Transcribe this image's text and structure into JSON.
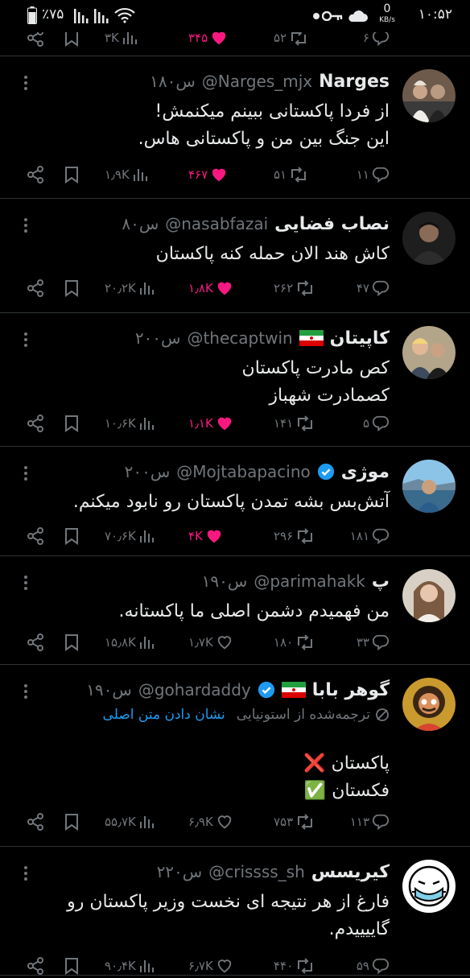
{
  "status_bar": {
    "time": "۱۰:۵۲",
    "net_speed_value": "0",
    "net_speed_unit": "KB/s",
    "battery": "٪۷۵",
    "icons": [
      "dot-icon",
      "key-icon",
      "cloud-icon",
      "wifi-icon",
      "signal-icon",
      "battery-icon"
    ]
  },
  "colors": {
    "background": "#000000",
    "text": "#e7e9ea",
    "muted": "#71767b",
    "like": "#f91880",
    "link": "#1d9bf0",
    "verified": "#1d9bf0"
  },
  "top_actions": {
    "replies": "۶",
    "retweets": "۵۲",
    "likes": "۳۴۵",
    "views": "۳K"
  },
  "tweets": [
    {
      "name": "Narges",
      "handle": "@Narges_mjx",
      "time": "۱۸۰س",
      "lines": [
        "از فردا پاکستانی ببینم میکنمش!",
        "این جنگ بین من و پاکستانی هاس."
      ],
      "replies": "۱۱",
      "retweets": "۵۱",
      "likes": "۴۶۷",
      "views": "۱٫۹K",
      "liked": true
    },
    {
      "name": "نصاب فضایی",
      "handle": "@nasabfazai",
      "time": "۸۰س",
      "lines": [
        "کاش هند الان حمله کنه پاکستان"
      ],
      "replies": "۴۷",
      "retweets": "۲۶۲",
      "likes": "۱٫۸K",
      "views": "۲۰٫۲K",
      "liked": true
    },
    {
      "name": "کاپیتان",
      "handle": "@thecaptwin",
      "time": "۲۰۰س",
      "lines": [
        "کص مادرت پاکستان",
        "کصمادرت شهباز"
      ],
      "replies": "۵",
      "retweets": "۱۴۱",
      "likes": "۱٫۱K",
      "views": "۱۰٫۶K",
      "liked": true
    },
    {
      "name": "موژی",
      "handle": "@Mojtabapacino",
      "time": "۲۰۰س",
      "lines": [
        "آتش‌بس بشه تمدن پاکستان رو نابود میکنم."
      ],
      "replies": "۱۸۱",
      "retweets": "۲۹۶",
      "likes": "۴K",
      "views": "۷۰٫۶K",
      "liked": true
    },
    {
      "name": "پ",
      "handle": "@parimahakk",
      "time": "۱۹۰س",
      "lines": [
        "من فهمیدم دشمن اصلی ما پاکستانه."
      ],
      "replies": "۳۳",
      "retweets": "۱۸۰",
      "likes": "۱٫۷K",
      "views": "۱۵٫۸K",
      "liked": false
    },
    {
      "name": "گوهر بابا",
      "handle": "@gohardaddy",
      "time": "۱۹۰س",
      "translate_label": "ترجمه‌شده از استونیایی",
      "translate_link": "نشان دادن متن اصلی",
      "lines": [
        "پاکستان ❌",
        "فکستان ✅"
      ],
      "replies": "۱۱۳",
      "retweets": "۷۵۳",
      "likes": "۶٫۹K",
      "views": "۵۵٫۷K",
      "liked": false
    },
    {
      "name": "کیریسس",
      "handle": "@crissss_sh",
      "time": "۲۲۰س",
      "lines": [
        "فارغ از هر نتیجه ای نخست وزیر پاکستان رو",
        "گاییییدم."
      ],
      "replies": "۵۹",
      "retweets": "۴۴۰",
      "likes": "۶٫۷K",
      "views": "۹۰٫۴K",
      "liked": false
    }
  ]
}
